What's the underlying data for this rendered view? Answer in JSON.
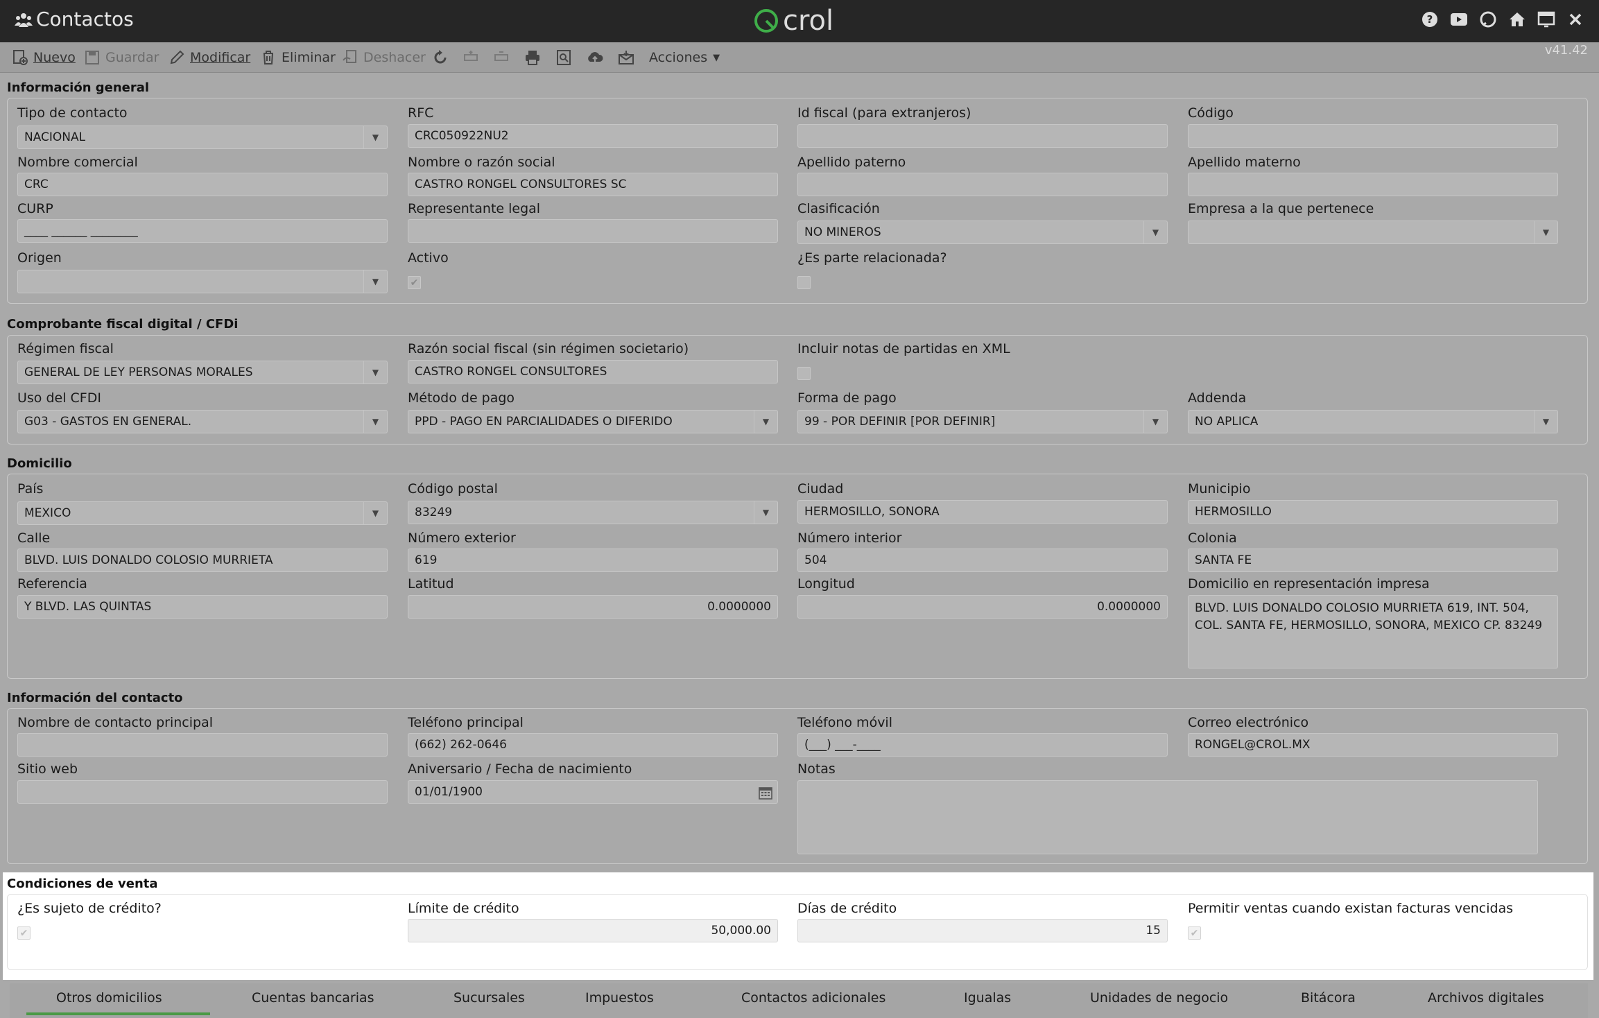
{
  "app": {
    "title": "Contactos",
    "logo_text": "crol",
    "version": "v41.42"
  },
  "title_icons": [
    "help-icon",
    "video-icon",
    "chat-icon",
    "home-icon",
    "window-icon",
    "close-icon"
  ],
  "toolbar": {
    "nuevo": "Nuevo",
    "guardar": "Guardar",
    "modificar": "Modificar",
    "eliminar": "Eliminar",
    "deshacer": "Deshacer",
    "acciones": "Acciones"
  },
  "general": {
    "title": "Información general",
    "tipo_contacto_label": "Tipo de contacto",
    "tipo_contacto": "NACIONAL",
    "rfc_label": "RFC",
    "rfc": "CRC050922NU2",
    "id_fiscal_label": "Id fiscal (para extranjeros)",
    "id_fiscal": "",
    "codigo_label": "Código",
    "codigo": "",
    "nombre_comercial_label": "Nombre comercial",
    "nombre_comercial": "CRC",
    "razon_social_label": "Nombre o razón social",
    "razon_social": "CASTRO RONGEL CONSULTORES SC",
    "apellido_paterno_label": "Apellido paterno",
    "apellido_paterno": "",
    "apellido_materno_label": "Apellido materno",
    "apellido_materno": "",
    "curp_label": "CURP",
    "curp": "____ ______ ________",
    "representante_label": "Representante legal",
    "representante": "",
    "clasificacion_label": "Clasificación",
    "clasificacion": "NO MINEROS",
    "empresa_label": "Empresa a la que pertenece",
    "empresa": "",
    "origen_label": "Origen",
    "origen": "",
    "activo_label": "Activo",
    "parte_relacionada_label": "¿Es parte relacionada?"
  },
  "cfdi": {
    "title": "Comprobante fiscal digital / CFDi",
    "regimen_label": "Régimen fiscal",
    "regimen": "GENERAL DE LEY PERSONAS MORALES",
    "razon_fiscal_label": "Razón social fiscal (sin régimen societario)",
    "razon_fiscal": "CASTRO RONGEL CONSULTORES",
    "notas_xml_label": "Incluir notas de partidas en XML",
    "uso_label": "Uso del CFDI",
    "uso": "G03 - GASTOS EN GENERAL.",
    "metodo_label": "Método de pago",
    "metodo": "PPD - PAGO EN PARCIALIDADES O DIFERIDO",
    "forma_label": "Forma de pago",
    "forma": "99 - POR DEFINIR [POR DEFINIR]",
    "addenda_label": "Addenda",
    "addenda": "NO APLICA"
  },
  "domicilio": {
    "title": "Domicilio",
    "pais_label": "País",
    "pais": "MEXICO",
    "cp_label": "Código postal",
    "cp": "83249",
    "ciudad_label": "Ciudad",
    "ciudad": "HERMOSILLO, SONORA",
    "municipio_label": "Municipio",
    "municipio": "HERMOSILLO",
    "calle_label": "Calle",
    "calle": "BLVD. LUIS DONALDO COLOSIO MURRIETA",
    "num_ext_label": "Número exterior",
    "num_ext": "619",
    "num_int_label": "Número interior",
    "num_int": "504",
    "colonia_label": "Colonia",
    "colonia": "SANTA FE",
    "referencia_label": "Referencia",
    "referencia": "Y BLVD. LAS QUINTAS",
    "latitud_label": "Latitud",
    "latitud": "0.0000000",
    "longitud_label": "Longitud",
    "longitud": "0.0000000",
    "impresa_label": "Domicilio en representación impresa",
    "impresa": "BLVD. LUIS DONALDO COLOSIO MURRIETA 619, INT. 504, COL. SANTA FE, HERMOSILLO, SONORA, MEXICO CP. 83249"
  },
  "contacto": {
    "title": "Información del contacto",
    "nombre_label": "Nombre de contacto principal",
    "nombre": "",
    "telefono_label": "Teléfono principal",
    "telefono": "(662) 262-0646",
    "movil_label": "Teléfono móvil",
    "movil": "(___) ___-____",
    "correo_label": "Correo electrónico",
    "correo": "RONGEL@CROL.MX",
    "sitio_label": "Sitio web",
    "sitio": "",
    "aniversario_label": "Aniversario / Fecha de nacimiento",
    "aniversario": "01/01/1900",
    "notas_label": "Notas",
    "notas": ""
  },
  "venta": {
    "title": "Condiciones de venta",
    "credito_label": "¿Es sujeto de crédito?",
    "limite_label": "Límite de crédito",
    "limite": "50,000.00",
    "dias_label": "Días de crédito",
    "dias": "15",
    "vencidas_label": "Permitir ventas cuando existan facturas vencidas"
  },
  "tabs": [
    "Otros domicilios",
    "Cuentas bancarias",
    "Sucursales",
    "Impuestos",
    "Contactos adicionales",
    "Igualas",
    "Unidades de negocio",
    "Bitácora",
    "Archivos digitales"
  ],
  "colors": {
    "titlebar": "#262626",
    "background": "#a9a9a9",
    "accent": "#4a9a45"
  }
}
